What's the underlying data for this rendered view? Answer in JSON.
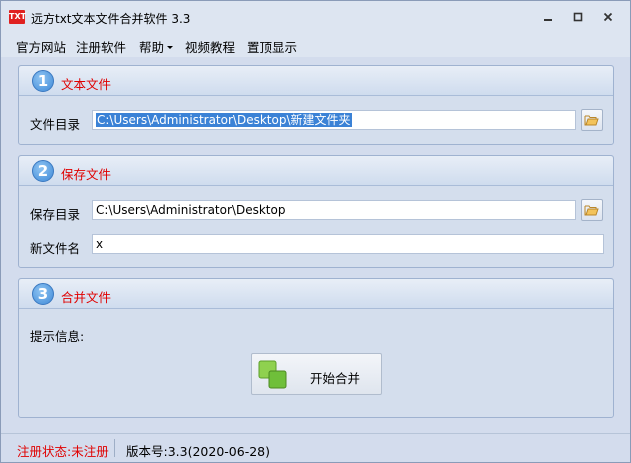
{
  "window": {
    "app_icon_text": "TXT",
    "title": "远方txt文本文件合并软件 3.3"
  },
  "menu": {
    "items": [
      {
        "label": "官方网站"
      },
      {
        "label": "注册软件"
      },
      {
        "label": "帮助",
        "has_dropdown": true
      },
      {
        "label": "视频教程"
      },
      {
        "label": "置顶显示"
      }
    ]
  },
  "panels": {
    "text_files": {
      "step": "1",
      "title": "文本文件",
      "dir_label": "文件目录",
      "dir_value": "C:\\Users\\Administrator\\Desktop\\新建文件夹"
    },
    "save_files": {
      "step": "2",
      "title": "保存文件",
      "dir_label": "保存目录",
      "dir_value": "C:\\Users\\Administrator\\Desktop",
      "name_label": "新文件名",
      "name_value": "x"
    },
    "merge": {
      "step": "3",
      "title": "合并文件",
      "info_label": "提示信息:",
      "button_label": "开始合并"
    }
  },
  "status": {
    "registration": "注册状态:未注册",
    "version": "版本号:3.3(2020-06-28)"
  },
  "colors": {
    "accent_red": "#e00000",
    "step_blue": "#3f8ad8",
    "selection": "#3b82d6"
  }
}
